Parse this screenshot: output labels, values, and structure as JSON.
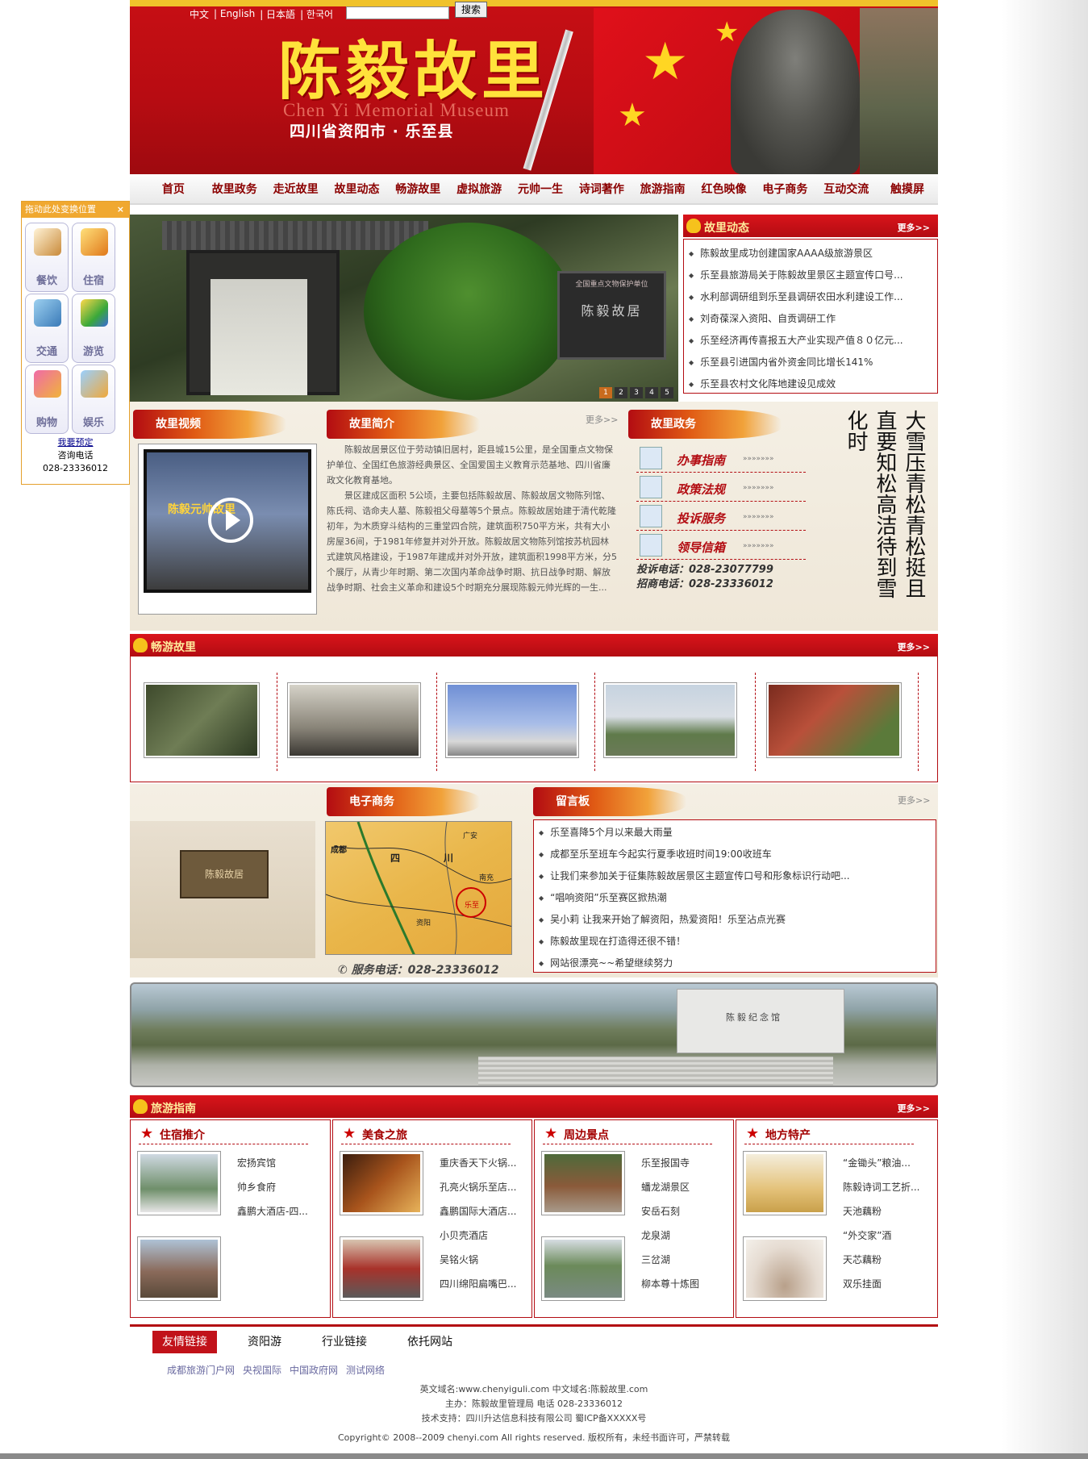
{
  "header": {
    "languages": [
      "中文",
      "| English",
      "| 日本語",
      "| 한국어"
    ],
    "search_button": "搜索",
    "title": "陈毅故里",
    "title_en": "Chen Yi   Memorial Museum",
    "subtitle": "四川省资阳市 · 乐至县"
  },
  "nav": [
    "首页",
    "故里政务",
    "走近故里",
    "故里动态",
    "畅游故里",
    "虚拟旅游",
    "元帅一生",
    "诗词著作",
    "旅游指南",
    "红色映像",
    "电子商务",
    "互动交流",
    "触摸屏"
  ],
  "banner": {
    "stele_line1": "全国重点文物保护单位",
    "stele_title": "陈毅故居",
    "pages": [
      "1",
      "2",
      "3",
      "4",
      "5"
    ],
    "active_page": "1"
  },
  "news": {
    "title": "故里动态",
    "more": "更多>>",
    "items": [
      "陈毅故里成功创建国家AAAA级旅游景区",
      "乐至县旅游局关于陈毅故里景区主题宣传口号...",
      "水利部调研组到乐至县调研农田水利建设工作...",
      "刘奇葆深入资阳、自贡调研工作",
      "乐至经济再传喜报五大产业实现产值８０亿元...",
      "乐至县引进国内省外资金同比增长141%",
      "乐至县农村文化阵地建设见成效"
    ]
  },
  "middle": {
    "video_title": "故里视频",
    "video_caption": "陈毅元帅故里",
    "intro_title": "故里简介",
    "intro_more": "更多>>",
    "intro_p1": "陈毅故居景区位于劳动镇旧居村，距县城15公里，是全国重点文物保护单位、全国红色旅游经典景区、全国爱国主义教育示范基地、四川省廉政文化教育基地。",
    "intro_p2": "景区建成区面积 5公顷，主要包括陈毅故居、陈毅故居文物陈列馆、陈氏祠、诰命夫人墓、陈毅祖父母墓等5个景点。陈毅故居始建于清代乾隆初年，为木质穿斗结构的三重堂四合院，建筑面积750平方米，共有大小房屋36间，于1981年修复并对外开放。陈毅故居文物陈列馆按苏杭园林式建筑风格建设，于1987年建成并对外开放，建筑面积1998平方米，分5个展厅，从青少年时期、第二次国内革命战争时期、抗日战争时期、解放战争时期、社会主义革命和建设5个时期充分展现陈毅元帅光辉的一生...",
    "gov_title": "故里政务",
    "gov_items": [
      "办事指南",
      "政策法规",
      "投诉服务",
      "领导信箱"
    ],
    "gov_dots": "»»»»»»»",
    "complaint_phone": "投诉电话：028-23077799",
    "invest_phone": "招商电话：028-23336012",
    "calligraphy": "大雪压青松青松挺且直要知松高洁待到雪化时"
  },
  "tour": {
    "title": "畅游故里",
    "more": "更多>>"
  },
  "ecommerce": {
    "title": "电子商务",
    "gate_text": "陈毅故居",
    "phone": "服务电话：028-23336012",
    "map_labels": [
      "成都",
      "四",
      "川",
      "广安",
      "资阳",
      "乐至",
      "南充"
    ]
  },
  "guestbook": {
    "title": "留言板",
    "more": "更多>>",
    "items": [
      "乐至喜降5个月以来最大雨量",
      "成都至乐至班车今起实行夏季收班时间19:00收班车",
      "让我们来参加关于征集陈毅故居景区主题宣传口号和形象标识行动吧...",
      "“唱响资阳”乐至赛区掀热潮",
      "吴小莉 让我来开始了解资阳，热爱资阳！乐至沾点光赛",
      "陈毅故里现在打造得还很不错！",
      "网站很漂亮~~希望继续努力"
    ]
  },
  "panorama": {
    "building_sign": "陈毅纪念馆"
  },
  "guide": {
    "title": "旅游指南",
    "more": "更多>>",
    "columns": [
      {
        "title": "住宿推介",
        "items": [
          "宏扬宾馆",
          "帅乡食府",
          "鑫鹏大酒店-四..."
        ]
      },
      {
        "title": "美食之旅",
        "items": [
          "重庆香天下火锅...",
          "孔亮火锅乐至店...",
          "鑫鹏国际大酒店...",
          "小贝壳酒店",
          "吴铭火锅",
          "四川绵阳扁嘴巴..."
        ]
      },
      {
        "title": "周边景点",
        "items": [
          "乐至报国寺",
          "蟠龙湖景区",
          "安岳石刻",
          "龙泉湖",
          "三岔湖",
          "柳本尊十炼图"
        ]
      },
      {
        "title": "地方特产",
        "items": [
          "“金锄头”粮油...",
          "陈毅诗词工艺折...",
          "天池藕粉",
          "“外交家”酒",
          "天芯藕粉",
          "双乐挂面"
        ]
      }
    ]
  },
  "links": {
    "tabs": [
      "友情链接",
      "资阳游",
      "行业链接",
      "依托网站"
    ],
    "items": [
      "成都旅游门户网",
      "央视国际",
      "中国政府网",
      "测试网络"
    ]
  },
  "footer": {
    "line1": "英文域名:www.chenyiguli.com      中文域名:陈毅故里.com",
    "line2": "主办：陈毅故里管理局  电话 028-23336012",
    "line3": "技术支持：四川升达信息科技有限公司  蜀ICP备XXXXX号",
    "copyright": "Copyright© 2008--2009 chenyi.com All rights reserved. 版权所有，未经书面许可，严禁转载"
  },
  "float_panel": {
    "title": "拖动此处变换位置",
    "close": "×",
    "items": [
      "餐饮",
      "住宿",
      "交通",
      "游览",
      "购物",
      "娱乐"
    ],
    "booking": "我要预定",
    "tel_label": "咨询电话",
    "tel": "028-23336012"
  },
  "colors": {
    "primary_red": "#b30c12",
    "gold": "#f0c22b",
    "float_orange": "#f0a830"
  }
}
